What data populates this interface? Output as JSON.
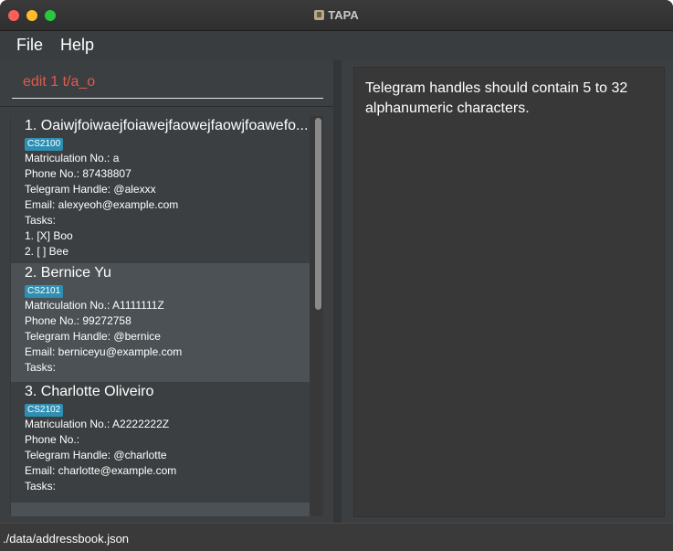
{
  "window": {
    "title": "TAPA"
  },
  "menu": {
    "file": "File",
    "help": "Help"
  },
  "command_box": {
    "value": "edit 1 t/a_o"
  },
  "result_display": {
    "text": "Telegram handles should contain 5 to 32 alphanumeric characters."
  },
  "persons": [
    {
      "name": "1.  Oaiwjfoiwaejfoiawejfaowejfaowjfoawefo...",
      "tag": "CS2100",
      "matric": "Matriculation No.: a",
      "phone": "Phone No.: 87438807",
      "telegram": "Telegram Handle: @alexxx",
      "email": "Email: alexyeoh@example.com",
      "tasks_label": "Tasks:",
      "tasks": [
        "1. [X] Boo",
        "2. [ ] Bee"
      ]
    },
    {
      "name": "2.  Bernice Yu",
      "tag": "CS2101",
      "matric": "Matriculation No.: A1111111Z",
      "phone": "Phone No.: 99272758",
      "telegram": "Telegram Handle: @bernice",
      "email": "Email: berniceyu@example.com",
      "tasks_label": "Tasks:",
      "tasks": []
    },
    {
      "name": "3.  Charlotte Oliveiro",
      "tag": "CS2102",
      "matric": "Matriculation No.: A2222222Z",
      "phone": "Phone No.:",
      "telegram": "Telegram Handle: @charlotte",
      "email": "Email: charlotte@example.com",
      "tasks_label": "Tasks:",
      "tasks": []
    }
  ],
  "status": {
    "path": "./data/addressbook.json"
  }
}
